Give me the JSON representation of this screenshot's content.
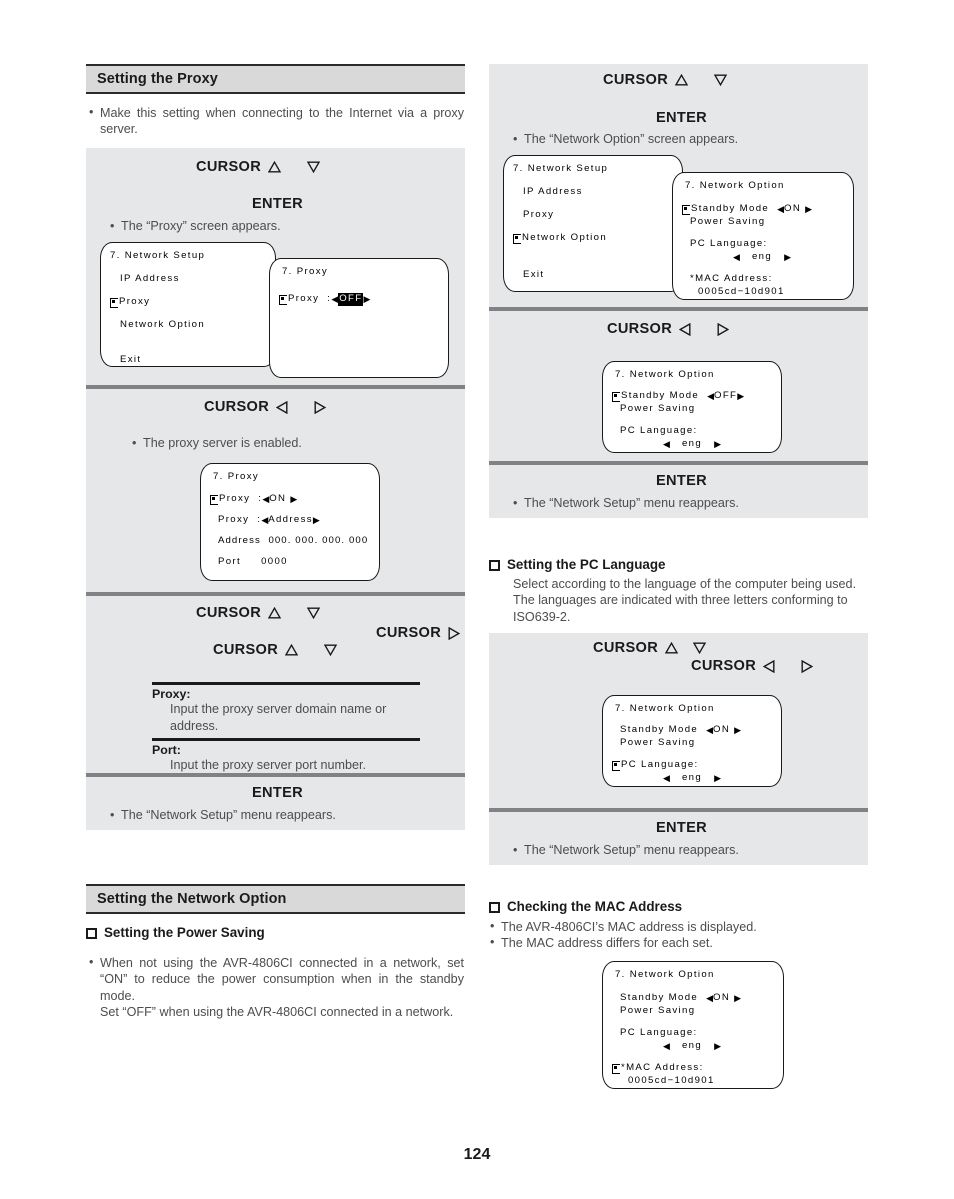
{
  "page": {
    "number": "124"
  },
  "glyphs": {
    "up": "△",
    "down": "▽",
    "left": "◁",
    "right": "▷",
    "osd_left": "◀",
    "osd_right": "▶",
    "checkbox": "❑",
    "pointer": "☞"
  },
  "left_column": {
    "section1": {
      "title": "Setting the Proxy",
      "intro": "Make this setting when connecting to the Internet via a proxy server.",
      "step1": {
        "key_cursor": "CURSOR",
        "key_enter": "ENTER",
        "note": "The “Proxy” screen appears.",
        "osd_network_setup": {
          "title": "7. Network Setup",
          "rows": [
            {
              "pointer": false,
              "text": "IP Address"
            },
            {
              "pointer": true,
              "text": "Proxy"
            },
            {
              "pointer": false,
              "text": "Network Option"
            },
            {
              "pointer": false,
              "text": "Exit"
            }
          ]
        },
        "osd_proxy": {
          "title": "7. Proxy",
          "label": "Proxy  :",
          "value": "OFF",
          "pointer": true,
          "highlighted": true
        }
      },
      "step2": {
        "key_cursor": "CURSOR",
        "note": "The proxy server is enabled.",
        "osd_proxy_on": {
          "title": "7. Proxy",
          "rows": [
            {
              "pointer": true,
              "label": "Proxy  :",
              "value": "ON",
              "arrows": true
            },
            {
              "pointer": false,
              "label": "Proxy  :",
              "value": "Address",
              "arrows": true
            },
            {
              "pointer": false,
              "label": "Address",
              "value": "000. 000. 000. 000",
              "arrows": false
            },
            {
              "pointer": false,
              "label": "Port",
              "value": "0000",
              "arrows": false
            }
          ]
        }
      },
      "step3": {
        "key_cursor": "CURSOR",
        "definitions": [
          {
            "term": "Proxy:",
            "desc": "Input the proxy server domain name or address."
          },
          {
            "term": "Port:",
            "desc": "Input the proxy server port number."
          }
        ]
      },
      "step4": {
        "key_enter": "ENTER",
        "note": "The “Network Setup” menu reappears."
      }
    },
    "section2": {
      "title": "Setting the Network Option",
      "sub1": {
        "heading": "Setting the Power Saving",
        "body": "When not using the AVR-4806CI connected in a network, set “ON” to reduce the power consumption when in the standby mode.\nSet “OFF” when using the AVR-4806CI connected in a network."
      }
    }
  },
  "right_column": {
    "step1": {
      "key_cursor": "CURSOR",
      "key_enter": "ENTER",
      "note": "The “Network Option” screen appears.",
      "osd_network_setup": {
        "title": "7. Network Setup",
        "rows": [
          {
            "pointer": false,
            "text": "IP Address"
          },
          {
            "pointer": false,
            "text": "Proxy"
          },
          {
            "pointer": true,
            "text": "Network Option"
          },
          {
            "pointer": false,
            "text": "Exit"
          }
        ]
      },
      "osd_network_option": {
        "title": "7. Network Option",
        "standby_label_1": "Standby Mode",
        "standby_label_2": "Power Saving",
        "standby_value": "ON",
        "standby_pointer": true,
        "lang_label": "PC Language:",
        "lang_value": "eng",
        "lang_pointer": false,
        "mac_label": "*MAC Address:",
        "mac_value": "0005cd−10d901",
        "mac_pointer": false
      }
    },
    "step2": {
      "key_cursor": "CURSOR",
      "osd_network_option": {
        "title": "7. Network Option",
        "standby_label_1": "Standby Mode",
        "standby_label_2": "Power Saving",
        "standby_value": "OFF",
        "standby_pointer": true,
        "lang_label": "PC Language:",
        "lang_value": "eng"
      }
    },
    "step3": {
      "key_enter": "ENTER",
      "note": "The “Network Setup” menu reappears."
    },
    "sub_pc_language": {
      "heading": "Setting the PC Language",
      "body": "Select according to the language of the computer being used. The languages are indicated with three letters conforming to ISO639-2.",
      "key_cursor_1": "CURSOR",
      "key_cursor_2": "CURSOR",
      "osd_network_option": {
        "title": "7. Network Option",
        "standby_label_1": "Standby Mode",
        "standby_label_2": "Power Saving",
        "standby_value": "ON",
        "standby_pointer": false,
        "lang_label": "PC Language:",
        "lang_value": "eng",
        "lang_pointer": true
      },
      "enter": {
        "key_enter": "ENTER",
        "note": "The “Network Setup” menu reappears."
      }
    },
    "sub_mac": {
      "heading": "Checking the MAC Address",
      "bullets": [
        "The AVR-4806CI’s MAC address is displayed.",
        "The MAC address differs for each set."
      ],
      "osd_network_option": {
        "title": "7. Network Option",
        "standby_label_1": "Standby Mode",
        "standby_label_2": "Power Saving",
        "standby_value": "ON",
        "lang_label": "PC Language:",
        "lang_value": "eng",
        "mac_label": "*MAC Address:",
        "mac_value": "0005cd−10d901",
        "mac_pointer": true
      }
    }
  }
}
